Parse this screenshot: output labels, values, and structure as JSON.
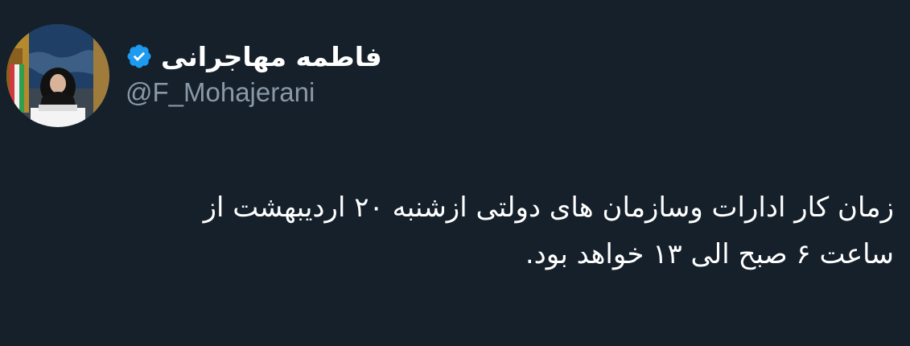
{
  "tweet": {
    "author": {
      "display_name": "فاطمه مهاجرانی",
      "handle": "@F_Mohajerani",
      "verified": true,
      "verified_icon": "verified-badge-icon",
      "avatar_icon": "profile-photo"
    },
    "text_lines": [
      "زمان کار ادارات وسازمان های دولتی ازشنبه ۲۰ اردیبهشت از",
      "ساعت ۶ صبح الی ۱۳ خواهد بود."
    ]
  },
  "colors": {
    "background": "#15202b",
    "text": "#ffffff",
    "secondary_text": "#8b98a5",
    "verified_blue": "#1d9bf0"
  }
}
